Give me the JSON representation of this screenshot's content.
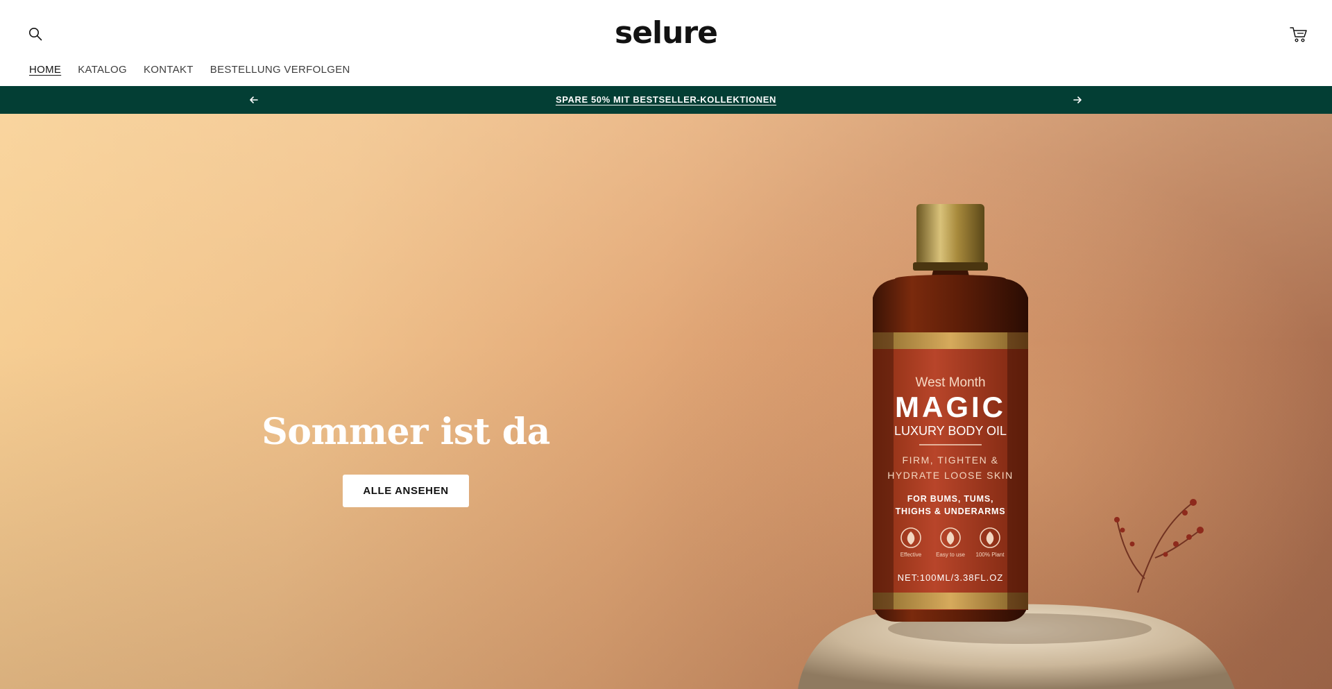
{
  "header": {
    "logo": "selure",
    "icons": {
      "search": "search-icon",
      "cart": "cart-icon"
    }
  },
  "nav": {
    "items": [
      {
        "label": "HOME",
        "active": true
      },
      {
        "label": "KATALOG",
        "active": false
      },
      {
        "label": "KONTAKT",
        "active": false
      },
      {
        "label": "BESTELLUNG VERFOLGEN",
        "active": false
      }
    ]
  },
  "announcement": {
    "text": "SPARE 50% MIT BESTSELLER-KOLLEKTIONEN",
    "icons": {
      "prev": "arrow-left-icon",
      "next": "arrow-right-icon"
    },
    "background": "#033e34"
  },
  "hero": {
    "title": "Sommer ist da",
    "cta_label": "ALLE ANSEHEN",
    "product": {
      "brand": "West Month",
      "name": "MAGIC",
      "subtitle": "LUXURY BODY OIL",
      "claim_line1": "FIRM, TIGHTEN &",
      "claim_line2": "HYDRATE LOOSE SKIN",
      "use_line1": "FOR BUMS, TUMS,",
      "use_line2": "THIGHS & UNDERARMS",
      "badges": [
        "Effective",
        "Easy to use",
        "100% Plant"
      ],
      "net": "NET:100ML/3.38FL.OZ"
    }
  }
}
